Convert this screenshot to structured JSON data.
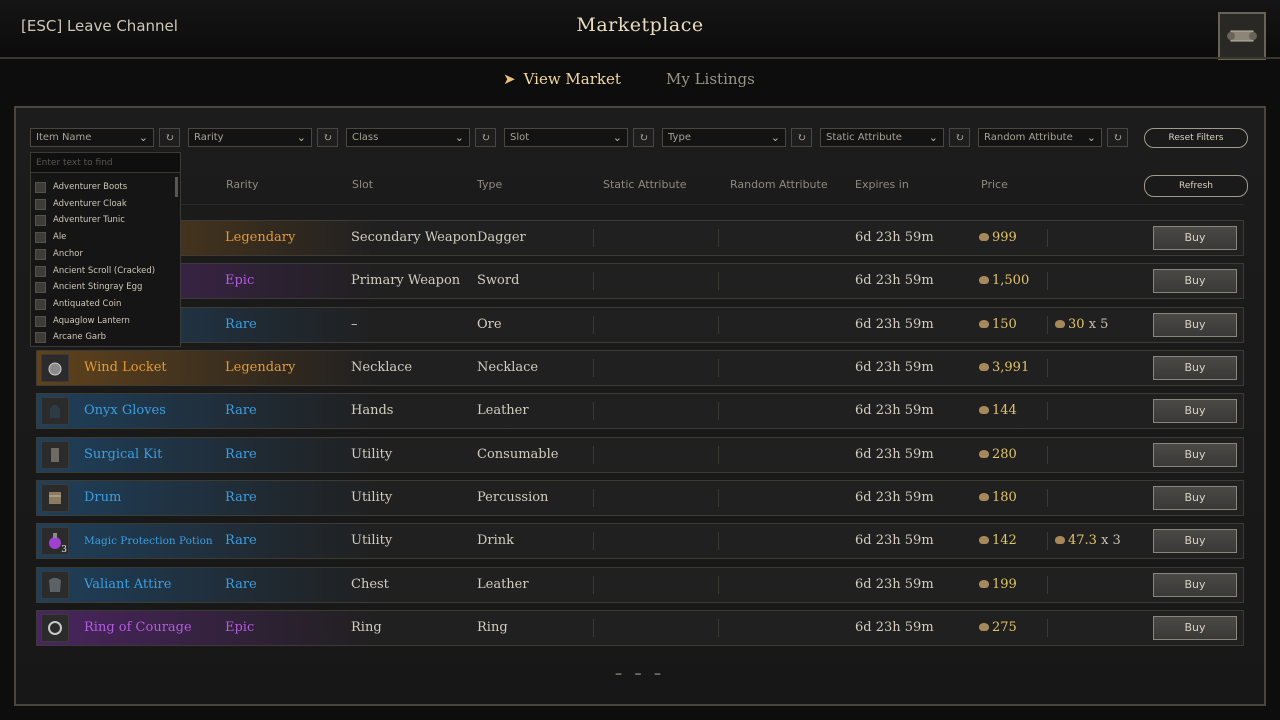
{
  "header": {
    "leave_label": "[ESC] Leave Channel",
    "title": "Marketplace"
  },
  "tabs": [
    {
      "label": "View Market",
      "active": true
    },
    {
      "label": "My Listings",
      "active": false
    }
  ],
  "filters": {
    "item_name": "Item Name",
    "rarity": "Rarity",
    "class": "Class",
    "slot": "Slot",
    "type": "Type",
    "static_attribute": "Static Attribute",
    "random_attribute": "Random Attribute",
    "reset_label": "Reset Filters",
    "refresh_label": "Refresh"
  },
  "dropdown": {
    "placeholder": "Enter text to find",
    "items": [
      "Adventurer Boots",
      "Adventurer Cloak",
      "Adventurer Tunic",
      "Ale",
      "Anchor",
      "Ancient Scroll (Cracked)",
      "Ancient Stingray Egg",
      "Antiquated Coin",
      "Aquaglow Lantern",
      "Arcane Garb"
    ]
  },
  "columns": {
    "rarity": "Rarity",
    "slot": "Slot",
    "type": "Type",
    "static_attribute": "Static Attribute",
    "random_attribute": "Random Attribute",
    "expires": "Expires in",
    "price": "Price"
  },
  "rows": [
    {
      "name": "",
      "rarity": "Legendary",
      "rarity_key": "legendary",
      "slot": "Secondary Weapon",
      "type": "Dagger",
      "expires": "6d 23h 59m",
      "price": "999",
      "unit_price": "",
      "icon": "dagger-icon",
      "buy": "Buy"
    },
    {
      "name": "",
      "rarity": "Epic",
      "rarity_key": "epic",
      "slot": "Primary Weapon",
      "type": "Sword",
      "expires": "6d 23h 59m",
      "price": "1,500",
      "unit_price": "",
      "icon": "sword-icon",
      "buy": "Buy"
    },
    {
      "name": "",
      "rarity": "Rare",
      "rarity_key": "rare",
      "slot": "–",
      "type": "Ore",
      "expires": "6d 23h 59m",
      "price": "150",
      "unit_price": "30",
      "qty": "x 5",
      "icon": "ore-icon",
      "buy": "Buy"
    },
    {
      "name": "Wind Locket",
      "rarity": "Legendary",
      "rarity_key": "legendary",
      "slot": "Necklace",
      "type": "Necklace",
      "expires": "6d 23h 59m",
      "price": "3,991",
      "unit_price": "",
      "icon": "locket-icon",
      "buy": "Buy"
    },
    {
      "name": "Onyx Gloves",
      "rarity": "Rare",
      "rarity_key": "rare",
      "slot": "Hands",
      "type": "Leather",
      "expires": "6d 23h 59m",
      "price": "144",
      "unit_price": "",
      "icon": "gloves-icon",
      "buy": "Buy"
    },
    {
      "name": "Surgical Kit",
      "rarity": "Rare",
      "rarity_key": "rare",
      "slot": "Utility",
      "type": "Consumable",
      "expires": "6d 23h 59m",
      "price": "280",
      "unit_price": "",
      "icon": "surgical-kit-icon",
      "buy": "Buy"
    },
    {
      "name": "Drum",
      "rarity": "Rare",
      "rarity_key": "rare",
      "slot": "Utility",
      "type": "Percussion",
      "expires": "6d 23h 59m",
      "price": "180",
      "unit_price": "",
      "icon": "drum-icon",
      "buy": "Buy"
    },
    {
      "name": "Magic Protection Potion",
      "rarity": "Rare",
      "rarity_key": "rare",
      "slot": "Utility",
      "type": "Drink",
      "expires": "6d 23h 59m",
      "price": "142",
      "unit_price": "47.3",
      "qty": "x 3",
      "stack": "3",
      "icon": "potion-icon",
      "buy": "Buy"
    },
    {
      "name": "Valiant Attire",
      "rarity": "Rare",
      "rarity_key": "rare",
      "slot": "Chest",
      "type": "Leather",
      "expires": "6d 23h 59m",
      "price": "199",
      "unit_price": "",
      "icon": "chest-armor-icon",
      "buy": "Buy"
    },
    {
      "name": "Ring of Courage",
      "rarity": "Epic",
      "rarity_key": "epic",
      "slot": "Ring",
      "type": "Ring",
      "expires": "6d 23h 59m",
      "price": "275",
      "unit_price": "",
      "icon": "ring-icon",
      "buy": "Buy"
    }
  ],
  "pager": "– – –",
  "colors": {
    "legendary": "#e59a35",
    "epic": "#b45be0",
    "rare": "#3c9ee0",
    "price": "#e2c46a"
  }
}
